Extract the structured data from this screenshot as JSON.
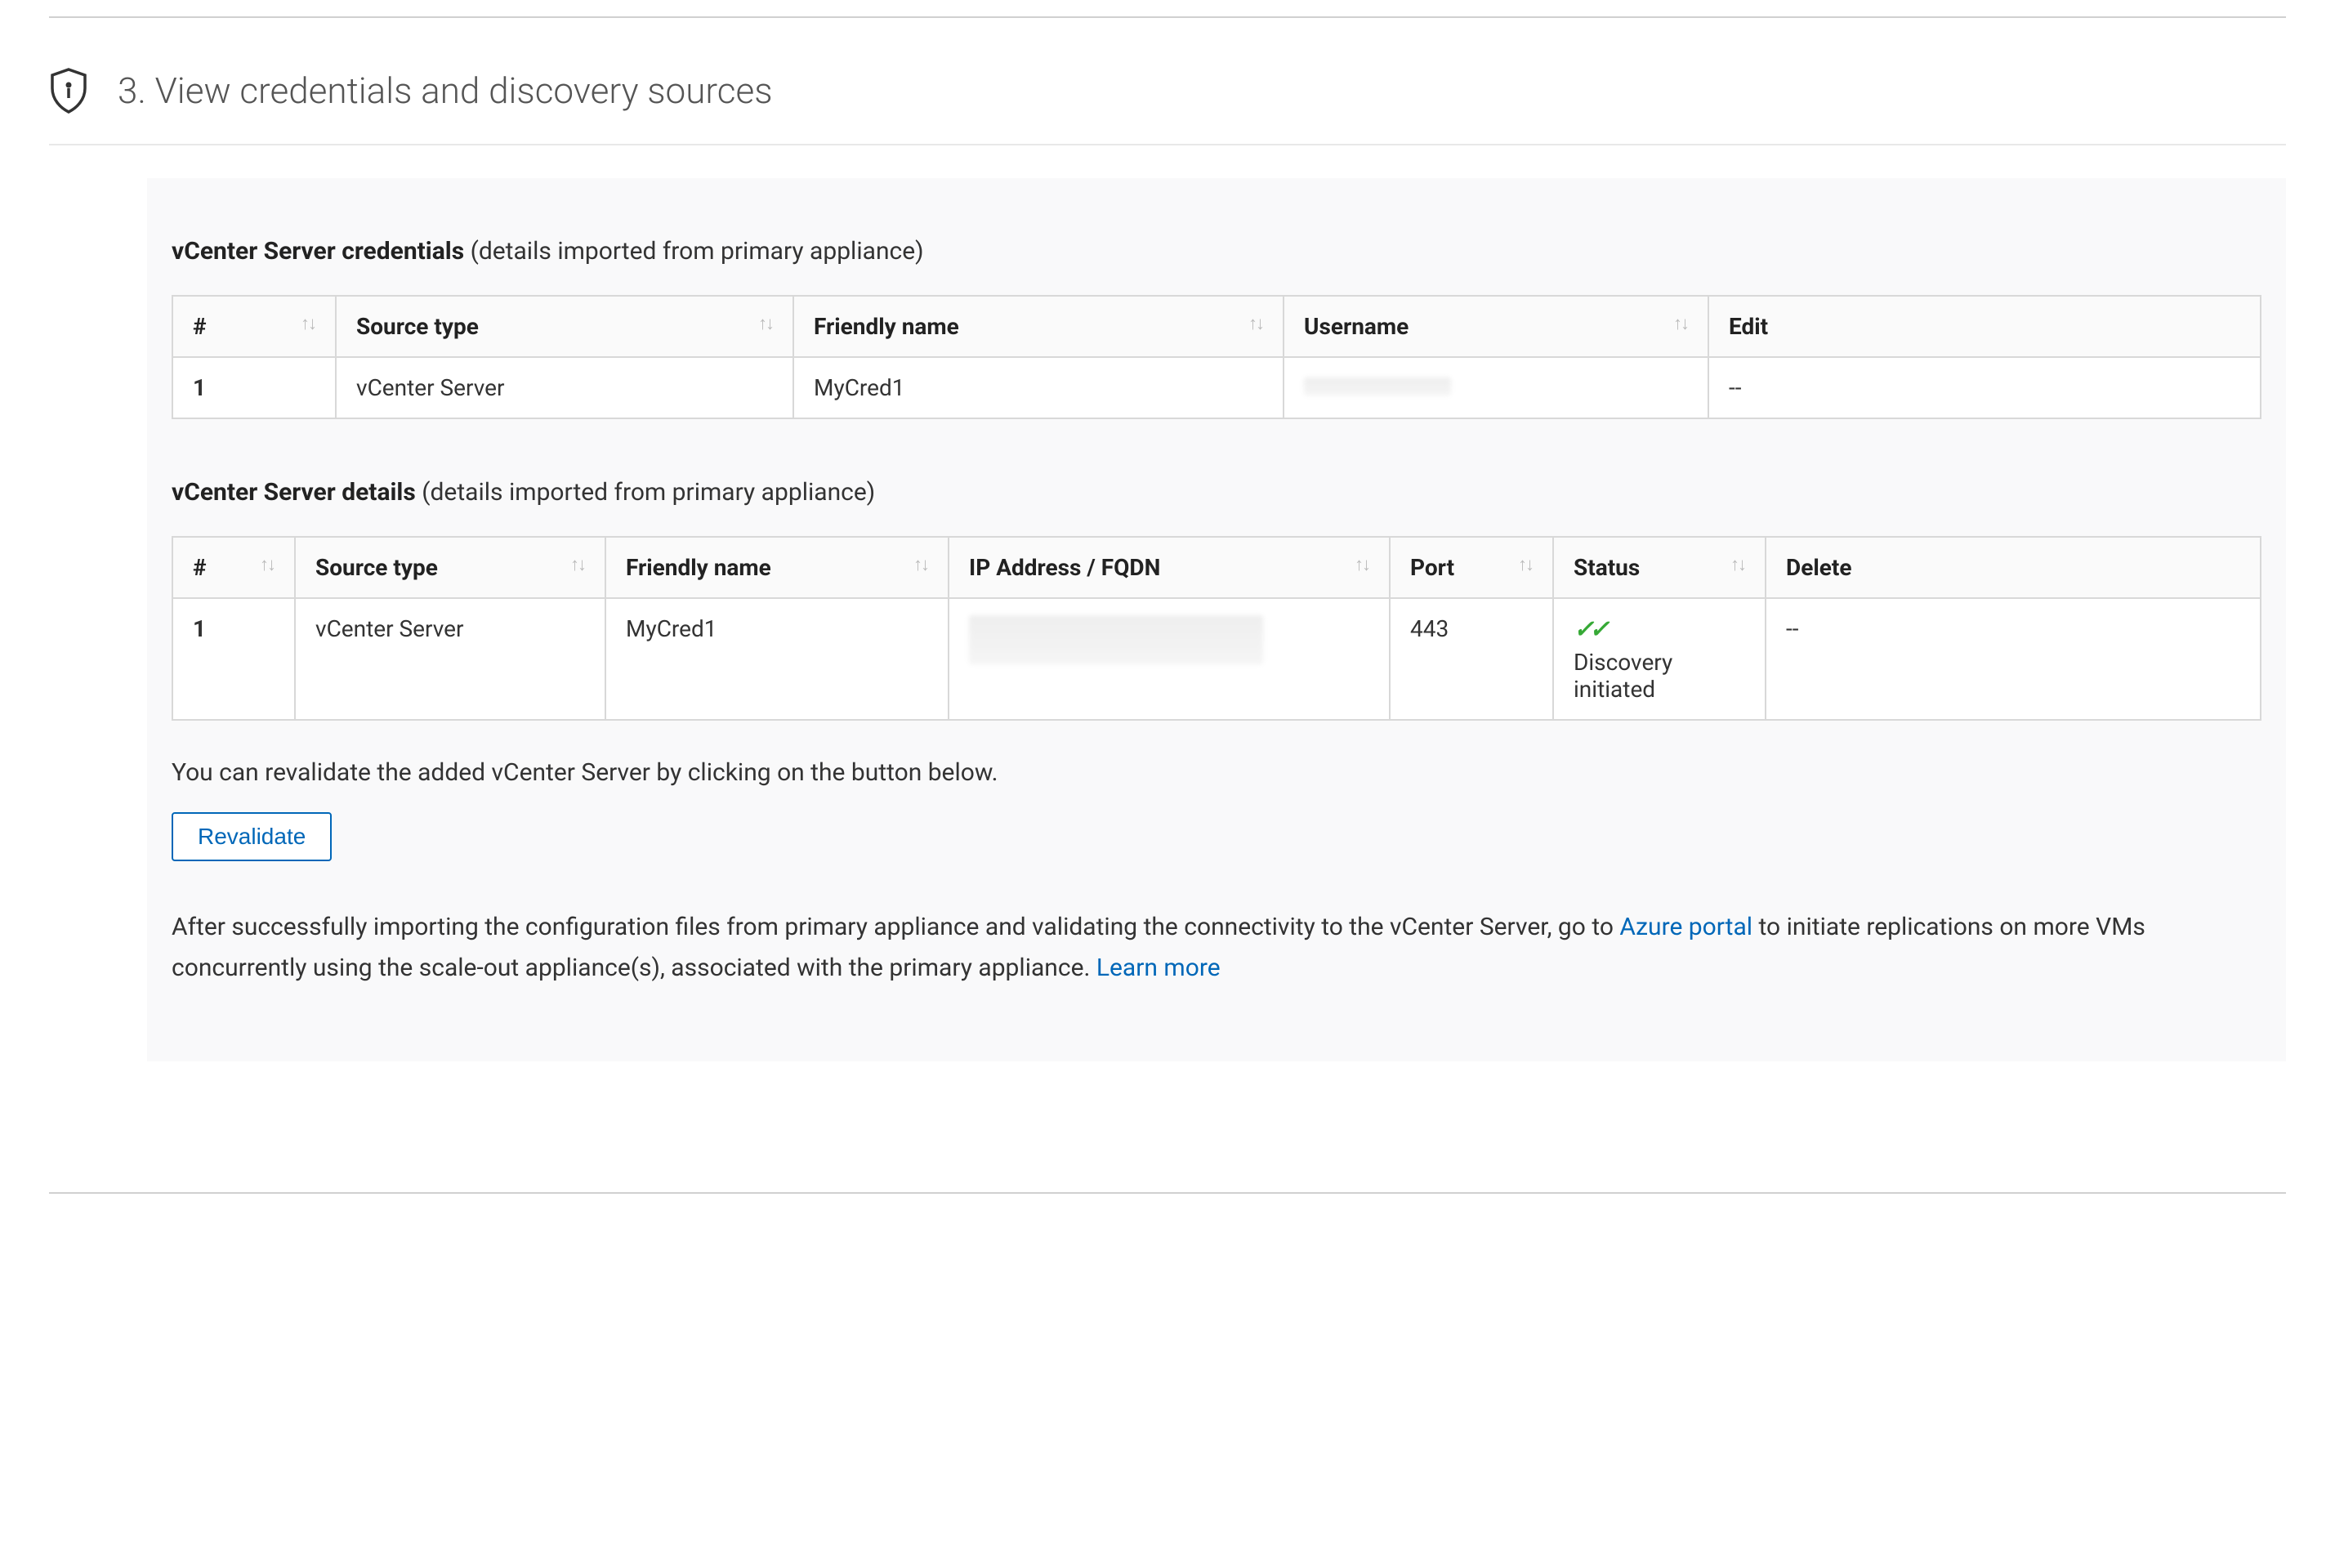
{
  "section_title": "3. View credentials and discovery sources",
  "credentials": {
    "title_strong": "vCenter Server credentials",
    "title_rest": " (details imported from primary appliance)",
    "columns": {
      "num": "#",
      "source_type": "Source type",
      "friendly_name": "Friendly name",
      "username": "Username",
      "edit": "Edit"
    },
    "row": {
      "num": "1",
      "source_type": "vCenter Server",
      "friendly_name": "MyCred1",
      "username": "",
      "edit": "--"
    }
  },
  "details": {
    "title_strong": "vCenter Server details",
    "title_rest": " (details imported from primary appliance)",
    "columns": {
      "num": "#",
      "source_type": "Source type",
      "friendly_name": "Friendly name",
      "ip_fqdn": "IP Address / FQDN",
      "port": "Port",
      "status": "Status",
      "delete": "Delete"
    },
    "row": {
      "num": "1",
      "source_type": "vCenter Server",
      "friendly_name": "MyCred1",
      "ip_fqdn": "",
      "port": "443",
      "status_text": "Discovery initiated",
      "delete": "--"
    }
  },
  "revalidate_help": "You can revalidate the added vCenter Server by clicking on the button below.",
  "revalidate_button": "Revalidate",
  "footer_note_pre": "After successfully importing the configuration files from primary appliance and validating the connectivity to the vCenter Server, go to ",
  "footer_link1": "Azure portal",
  "footer_note_mid": " to initiate replications on more VMs concurrently using the scale-out appliance(s), associated with the primary appliance. ",
  "footer_link2": "Learn more"
}
